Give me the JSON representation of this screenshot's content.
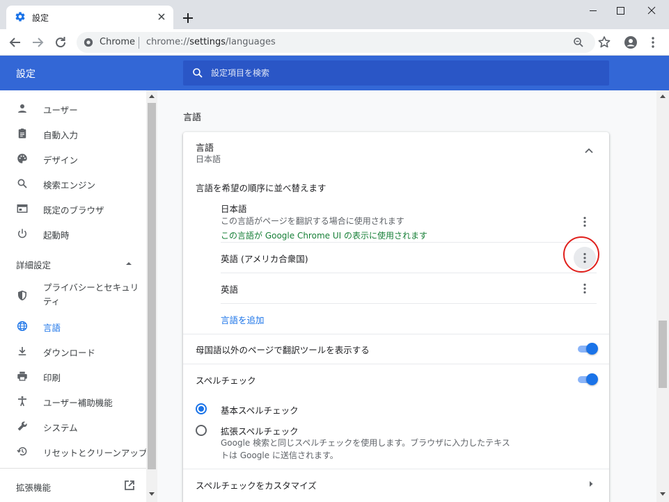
{
  "browser": {
    "tab_title": "設定",
    "site_chip": "Chrome",
    "url_scheme": "chrome://",
    "url_host": "settings",
    "url_path": "/languages"
  },
  "header": {
    "title": "設定",
    "search_placeholder": "設定項目を検索"
  },
  "sidebar": {
    "items": [
      {
        "label": "ユーザー",
        "icon": "person-icon"
      },
      {
        "label": "自動入力",
        "icon": "clipboard-icon"
      },
      {
        "label": "デザイン",
        "icon": "palette-icon"
      },
      {
        "label": "検索エンジン",
        "icon": "search-icon"
      },
      {
        "label": "既定のブラウザ",
        "icon": "browser-window-icon"
      },
      {
        "label": "起動時",
        "icon": "power-icon"
      }
    ],
    "advanced_label": "詳細設定",
    "advanced_items": [
      {
        "label": "プライバシーとセキュリティ",
        "icon": "shield-icon"
      },
      {
        "label": "言語",
        "icon": "globe-icon",
        "active": true
      },
      {
        "label": "ダウンロード",
        "icon": "download-icon"
      },
      {
        "label": "印刷",
        "icon": "printer-icon"
      },
      {
        "label": "ユーザー補助機能",
        "icon": "accessibility-icon"
      },
      {
        "label": "システム",
        "icon": "wrench-icon"
      },
      {
        "label": "リセットとクリーンアップ",
        "icon": "restore-icon"
      }
    ],
    "extensions_label": "拡張機能"
  },
  "main": {
    "section_title": "言語",
    "card": {
      "title": "言語",
      "current_language": "日本語",
      "order_label": "言語を希望の順序に並べ替えます",
      "languages": [
        {
          "name": "日本語",
          "description": "この言語がページを翻訳する場合に使用されます",
          "ui_note": "この言語が Google Chrome UI の表示に使用されます"
        },
        {
          "name": "英語 (アメリカ合衆国)"
        },
        {
          "name": "英語"
        }
      ],
      "add_language": "言語を追加",
      "translate_offer_label": "母国語以外のページで翻訳ツールを表示する",
      "translate_offer_on": true,
      "spellcheck_label": "スペルチェック",
      "spellcheck_on": true,
      "basic_spellcheck": "基本スペルチェック",
      "enhanced_spellcheck": "拡張スペルチェック",
      "enhanced_spellcheck_desc": "Google 検索と同じスペルチェックを使用します。ブラウザに入力したテキストは Google に送信されます。",
      "customize_spellcheck": "スペルチェックをカスタマイズ"
    }
  },
  "colors": {
    "header_blue": "#3367d6",
    "accent": "#1a73e8",
    "ui_note_green": "#188038",
    "highlight_red": "#e0201c"
  }
}
